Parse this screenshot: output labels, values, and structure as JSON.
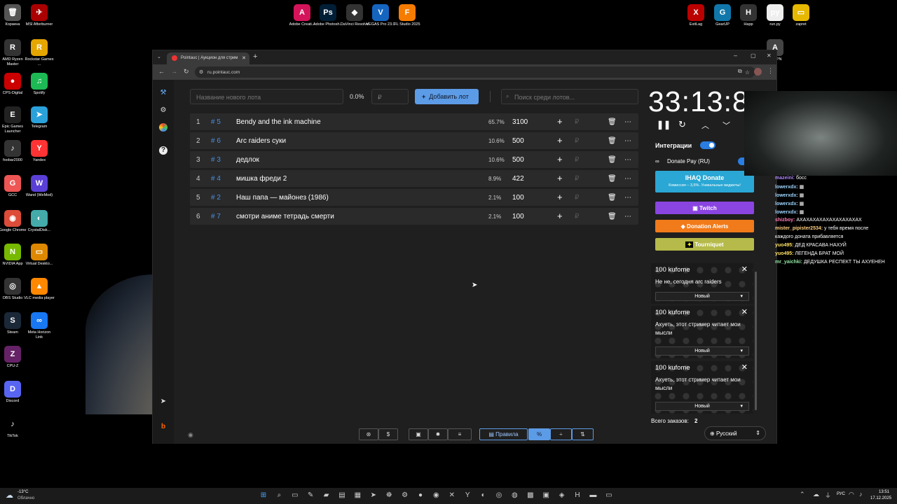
{
  "desktop": {
    "icons": [
      {
        "label": "Корзина",
        "glyph": "🗑",
        "color": "#555"
      },
      {
        "label": "MSI Afterburner",
        "glyph": "✈",
        "color": "#a00"
      },
      {
        "label": "AMD Ryzen Master",
        "glyph": "R",
        "color": "#333"
      },
      {
        "label": "Rockstar Games ...",
        "glyph": "R",
        "color": "#e6a600"
      },
      {
        "label": "CPS-Digital",
        "glyph": "●",
        "color": "#c00"
      },
      {
        "label": "Spotify",
        "glyph": "♫",
        "color": "#1db954"
      },
      {
        "label": "Epic Games Launcher",
        "glyph": "E",
        "color": "#222"
      },
      {
        "label": "Telegram",
        "glyph": "➤",
        "color": "#2aa1da"
      },
      {
        "label": "foobar2000",
        "glyph": "♪",
        "color": "#333"
      },
      {
        "label": "Yandex",
        "glyph": "Y",
        "color": "#f33"
      },
      {
        "label": "GCC",
        "glyph": "G",
        "color": "#e55"
      },
      {
        "label": "Wand (WeMod)",
        "glyph": "W",
        "color": "#5a3fd6"
      },
      {
        "label": "Google Chrome",
        "glyph": "◉",
        "color": "#dd4b39"
      },
      {
        "label": "CrystalDisk...",
        "glyph": "◐",
        "color": "#4aa"
      },
      {
        "label": "NVIDIA App",
        "glyph": "N",
        "color": "#76b900"
      },
      {
        "label": "Virtual Deskto...",
        "glyph": "▭",
        "color": "#d80"
      },
      {
        "label": "OBS Studio",
        "glyph": "◎",
        "color": "#333"
      },
      {
        "label": "VLC media player",
        "glyph": "▲",
        "color": "#f80"
      },
      {
        "label": "Steam",
        "glyph": "S",
        "color": "#1b2838"
      },
      {
        "label": "Meta Horizon Link",
        "glyph": "∞",
        "color": "#1877f2"
      },
      {
        "label": "CPU-Z",
        "glyph": "Z",
        "color": "#626"
      },
      {
        "label": "Discord",
        "glyph": "D",
        "color": "#5865f2"
      },
      {
        "label": "TikTok",
        "glyph": "♪",
        "color": "#000"
      },
      {
        "label": "Adobe Creati...",
        "glyph": "A",
        "color": "#d4145a"
      },
      {
        "label": "Adobe Photosh...",
        "glyph": "Ps",
        "color": "#001e36"
      },
      {
        "label": "DaVinci Resolve",
        "glyph": "◆",
        "color": "#333"
      },
      {
        "label": "VEGAS Pro 23.0",
        "glyph": "V",
        "color": "#1565c0"
      },
      {
        "label": "FL Studio 2025",
        "glyph": "F",
        "color": "#f57c00"
      },
      {
        "label": "ExitLag",
        "glyph": "X",
        "color": "#b00"
      },
      {
        "label": "GearUP",
        "glyph": "G",
        "color": "#17a"
      },
      {
        "label": "Happ",
        "glyph": "H",
        "color": "#333"
      },
      {
        "label": "run.py",
        "glyph": "py",
        "color": "#eee"
      },
      {
        "label": "zapret",
        "glyph": "▭",
        "color": "#e6b800"
      },
      {
        "label": "...aVPN",
        "glyph": "A",
        "color": "#444"
      }
    ]
  },
  "browser": {
    "tab_title": "Pointauc | Аукцион для стрим",
    "url": "ru.pointauc.com"
  },
  "auction": {
    "new_lot_placeholder": "Название нового лота",
    "percent": "0.0%",
    "amount_placeholder": "₽",
    "add_button": "Добавить лот",
    "search_placeholder": "Поиск среди лотов...",
    "currency": "₽",
    "lots": [
      {
        "rank": "1",
        "id": "# 5",
        "name": "Bendy and the ink machine",
        "percent": "65.7%",
        "amount": "3100"
      },
      {
        "rank": "2",
        "id": "# 6",
        "name": "Arc raiders суки",
        "percent": "10.6%",
        "amount": "500"
      },
      {
        "rank": "3",
        "id": "# 3",
        "name": "дедлок",
        "percent": "10.6%",
        "amount": "500"
      },
      {
        "rank": "4",
        "id": "# 4",
        "name": "мишка фреди 2",
        "percent": "8.9%",
        "amount": "422"
      },
      {
        "rank": "5",
        "id": "# 2",
        "name": "Наш папа — майонез (1986)",
        "percent": "2.1%",
        "amount": "100"
      },
      {
        "rank": "6",
        "id": "# 7",
        "name": "смотри аниме тетрадь смерти",
        "percent": "2.1%",
        "amount": "100"
      }
    ],
    "rules_button": "Правила"
  },
  "side": {
    "timer": "33:13:8",
    "integrations_label": "Интеграции",
    "donatepay_label": "Donate Pay (RU)",
    "ihaq_title": "IHAQ Donate",
    "ihaq_sub": "Комиссия – 3,5%. Уникальные виджеты!",
    "twitch": "Twitch",
    "donation_alerts": "Donation Alerts",
    "tourniquet": "Tourniquet",
    "cards": [
      {
        "title": "100 kufome",
        "text": "Не не, сегодня arc raiders",
        "select": "Новый"
      },
      {
        "title": "100 kufome",
        "text": "Ахуеть, этот стример читает мои мысли",
        "select": "Новый"
      },
      {
        "title": "100 kufome",
        "text": "Ахуеть, этот стример читает мои мысли",
        "select": "Новый"
      }
    ],
    "orders_label": "Всего заказов:",
    "orders_count": "2",
    "language": "Русский"
  },
  "chat": {
    "messages": [
      {
        "user": "mazeini:",
        "text": "босс",
        "color": "#b48cff"
      },
      {
        "user": "lowerxdx:",
        "text": "▦",
        "color": "#9fd6ff"
      },
      {
        "user": "lowerxdx:",
        "text": "▦",
        "color": "#9fd6ff"
      },
      {
        "user": "lowerxdx:",
        "text": "▦",
        "color": "#9fd6ff"
      },
      {
        "user": "lowerxdx:",
        "text": "▦",
        "color": "#9fd6ff"
      },
      {
        "user": "shizboy:",
        "text": "АХАХАХАХАХАХАХАХАХАХ",
        "color": "#ff7ab6"
      },
      {
        "user": "mister_pipister2534:",
        "text": "у тебя время после",
        "color": "#ffd080"
      },
      {
        "user": "",
        "text": "каждого доната прибавляется",
        "color": "#ffd080"
      },
      {
        "user": "yuo495:",
        "text": "ДЕД КРАСАВА НАХУЙ",
        "color": "#ffe066"
      },
      {
        "user": "yuo495:",
        "text": "ЛЕГЕНДА БРАТ МОЙ",
        "color": "#ffe066"
      },
      {
        "user": "mr_yaichki:",
        "text": "ДЕДУШКА РЕСПЕКТ ТЫ АХУЕНЕН",
        "color": "#8fe3a0"
      }
    ]
  },
  "taskbar": {
    "weather_temp": "-13°C",
    "weather_desc": "Облачно",
    "lang": "РУС",
    "time": "13:51",
    "date": "17.12.2025"
  }
}
